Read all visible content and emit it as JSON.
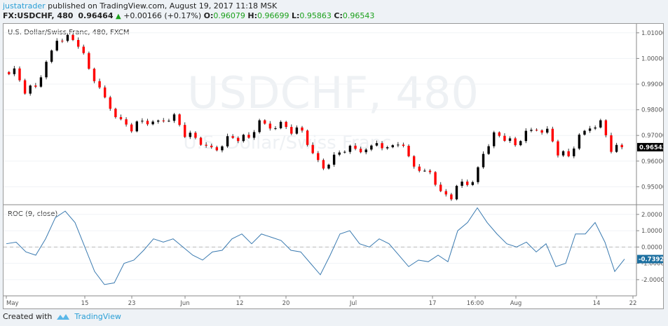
{
  "header": {
    "user": "justatrader",
    "published": "published on TradingView.com, August 19, 2017 11:18 MSK",
    "symbol": "FX:USDCHF, 480",
    "last": "0.96464",
    "change": "+0.00166 (+0.17%)",
    "o_label": "O:",
    "o": "0.96079",
    "h_label": "H:",
    "h": "0.96699",
    "l_label": "L:",
    "l": "0.95863",
    "c_label": "C:",
    "c": "0.96543"
  },
  "chart": {
    "title": "U.S. Dollar/Swiss Franc, 480, FXCM",
    "watermark": "USDCHF, 480",
    "watermark_sub": "U.S. Dollar/Swiss Franc",
    "indicator_title": "ROC (9, close)",
    "colors": {
      "up": "#000000",
      "down": "#ff0000",
      "roc": "#3a7ab0",
      "price_tag": "#000000",
      "roc_tag": "#1c6fa0"
    }
  },
  "chart_data": [
    {
      "type": "candlestick",
      "title": "U.S. Dollar/Swiss Franc, 480, FXCM",
      "y_ticks": [
        "1.01000",
        "1.00000",
        "0.99000",
        "0.98000",
        "0.97000",
        "0.96000",
        "0.95000"
      ],
      "ylim": [
        0.943,
        1.0135
      ],
      "last_price_label": "0.96543",
      "closes": [
        0.9947,
        0.9955,
        0.9875,
        0.989,
        0.9975,
        1.0075,
        1.0086,
        1.0058,
        0.996,
        0.9875,
        0.981,
        0.9757,
        0.9728,
        0.9757,
        0.9742,
        0.9762,
        0.9776,
        0.9706,
        0.9691,
        0.9648,
        0.9648,
        0.9691,
        0.969,
        0.9691,
        0.9747,
        0.9733,
        0.9747,
        0.9719,
        0.9719,
        0.9619,
        0.9577,
        0.9619,
        0.9648,
        0.9648,
        0.9633,
        0.9676,
        0.9648,
        0.9676,
        0.9619,
        0.955,
        0.9563,
        0.9477,
        0.9463,
        0.952,
        0.9506,
        0.9634,
        0.9706,
        0.9691,
        0.9662,
        0.9706,
        0.9726,
        0.972,
        0.9634,
        0.9619,
        0.9691,
        0.9733,
        0.9753,
        0.9648,
        0.9654
      ]
    },
    {
      "type": "line",
      "title": "ROC (9, close)",
      "y_ticks": [
        "2.0000",
        "1.0000",
        "0.0000",
        "-1.0000",
        "-2.0000"
      ],
      "ylim": [
        -2.95,
        2.55
      ],
      "last_value_label": "-0.7392",
      "values": [
        0.2,
        0.3,
        -0.3,
        -0.5,
        0.5,
        1.8,
        2.2,
        1.5,
        0,
        -1.5,
        -2.3,
        -2.2,
        -1.0,
        -0.8,
        -0.2,
        0.5,
        0.3,
        0.5,
        0,
        -0.5,
        -0.8,
        -0.3,
        -0.2,
        0.5,
        0.8,
        0.2,
        0.8,
        0.6,
        0.4,
        -0.2,
        -0.3,
        -1.0,
        -1.7,
        -0.5,
        0.8,
        1.0,
        0.2,
        0,
        0.5,
        0.2,
        -0.5,
        -1.2,
        -0.8,
        -0.9,
        -0.5,
        -0.9,
        1.0,
        1.5,
        2.4,
        1.5,
        0.8,
        0.2,
        0,
        0.3,
        -0.3,
        0.2,
        -1.2,
        -1.0,
        0.8,
        0.8,
        1.5,
        0.3,
        -1.5,
        -0.7392
      ]
    },
    {
      "x_ticks": [
        "May",
        "15",
        "23",
        "Jun",
        "12",
        "20",
        "Jul",
        "17",
        "16:00",
        "Aug",
        "14",
        "22"
      ]
    }
  ],
  "footer": {
    "created": "Created with",
    "brand": "TradingView"
  }
}
